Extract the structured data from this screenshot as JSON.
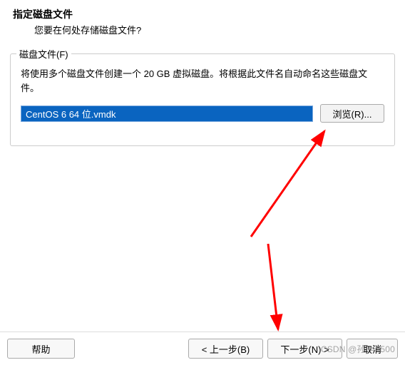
{
  "header": {
    "title": "指定磁盘文件",
    "subtitle": "您要在何处存储磁盘文件?"
  },
  "fieldset": {
    "legend": "磁盘文件(F)",
    "description": "将使用多个磁盘文件创建一个 20 GB 虚拟磁盘。将根据此文件名自动命名这些磁盘文件。",
    "file_value": "CentOS 6 64 位.vmdk",
    "browse_label": "浏览(R)..."
  },
  "footer": {
    "help_label": "帮助",
    "back_label": "< 上一步(B)",
    "next_label": "下一步(N) >",
    "cancel_label": "取消"
  },
  "watermark": "CSDN @孙841500"
}
